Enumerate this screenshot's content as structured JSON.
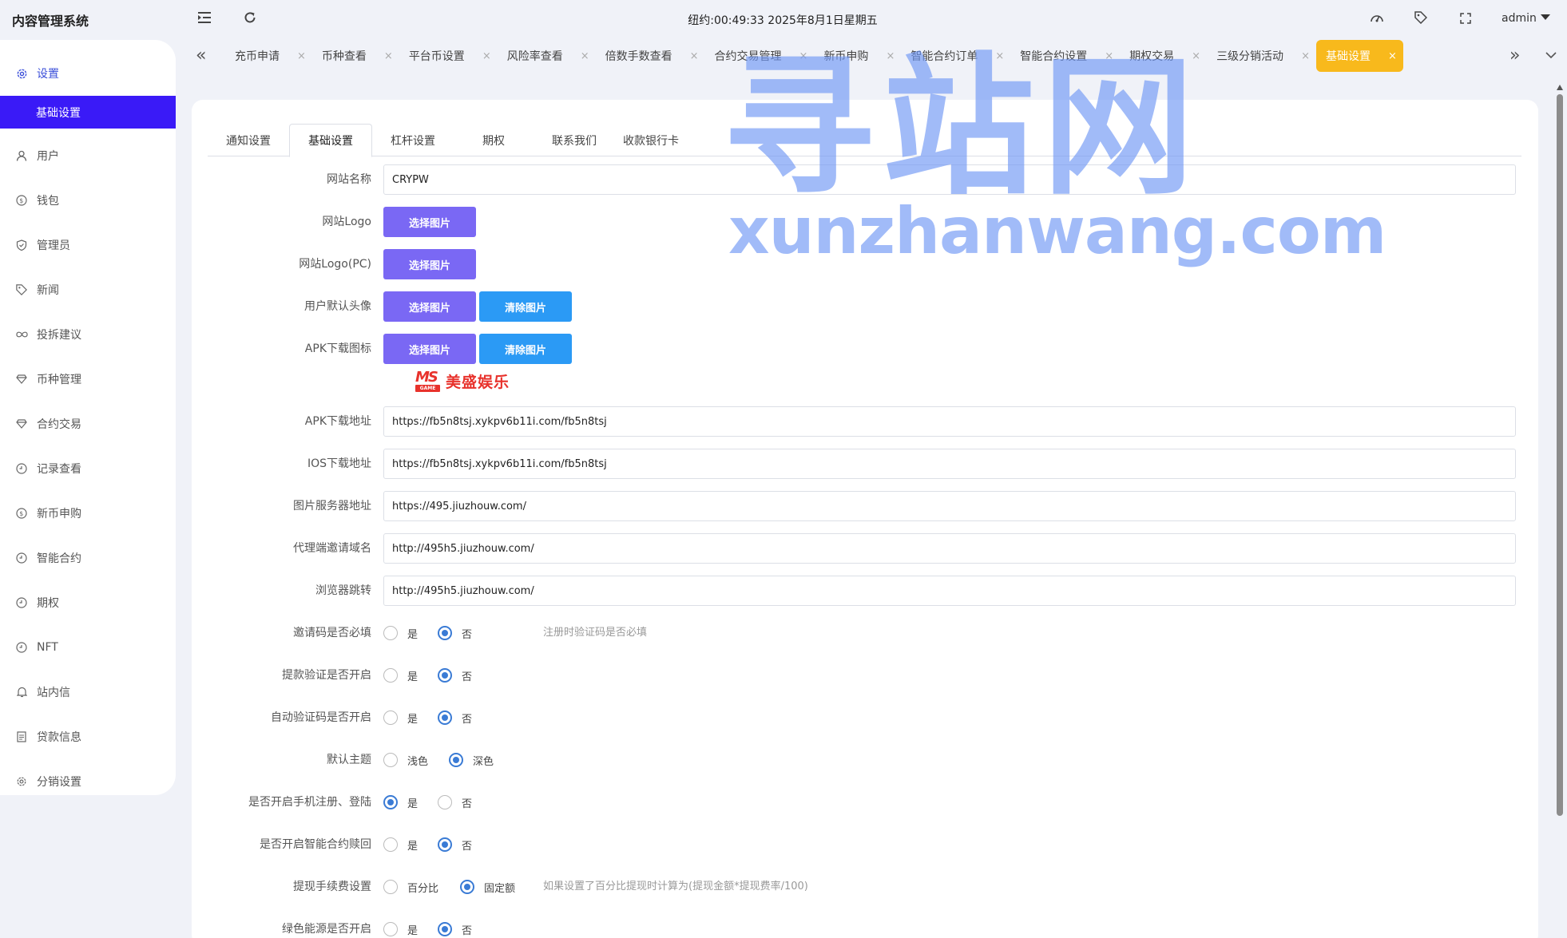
{
  "app": {
    "title": "内容管理系统"
  },
  "topbar": {
    "clock": "纽约:00:49:33 2025年8月1日星期五",
    "user": "admin"
  },
  "sidebar": {
    "items": [
      {
        "label": "设置",
        "icon": "gear-icon"
      },
      {
        "label": "基础设置",
        "icon": ""
      },
      {
        "label": "用户",
        "icon": "user-icon"
      },
      {
        "label": "钱包",
        "icon": "coin-icon"
      },
      {
        "label": "管理员",
        "icon": "shield-icon"
      },
      {
        "label": "新闻",
        "icon": "tag-icon"
      },
      {
        "label": "投拆建议",
        "icon": "infinity-icon"
      },
      {
        "label": "币种管理",
        "icon": "diamond-icon"
      },
      {
        "label": "合约交易",
        "icon": "diamond-icon"
      },
      {
        "label": "记录查看",
        "icon": "clock-icon"
      },
      {
        "label": "新币申购",
        "icon": "coin-icon"
      },
      {
        "label": "智能合约",
        "icon": "clock-icon"
      },
      {
        "label": "期权",
        "icon": "clock-icon"
      },
      {
        "label": "NFT",
        "icon": "clock-icon"
      },
      {
        "label": "站内信",
        "icon": "bell-icon"
      },
      {
        "label": "贷款信息",
        "icon": "document-icon"
      },
      {
        "label": "分销设置",
        "icon": "gear-icon"
      }
    ]
  },
  "tabs": [
    {
      "label": "充币申请"
    },
    {
      "label": "币种查看"
    },
    {
      "label": "平台币设置"
    },
    {
      "label": "风险率查看"
    },
    {
      "label": "倍数手数查看"
    },
    {
      "label": "合约交易管理"
    },
    {
      "label": "新币申购"
    },
    {
      "label": "智能合约订单"
    },
    {
      "label": "智能合约设置"
    },
    {
      "label": "期权交易"
    },
    {
      "label": "三级分销活动"
    },
    {
      "label": "基础设置"
    }
  ],
  "inner_tabs": [
    "通知设置",
    "基础设置",
    "杠杆设置",
    "期权",
    "联系我们",
    "收款银行卡"
  ],
  "form": {
    "site_name": {
      "label": "网站名称",
      "value": "CRYPW"
    },
    "site_logo": {
      "label": "网站Logo",
      "button": "选择图片"
    },
    "site_logo_pc": {
      "label": "网站Logo(PC)",
      "button": "选择图片"
    },
    "default_avatar": {
      "label": "用户默认头像",
      "select": "选择图片",
      "clear": "清除图片"
    },
    "apk_icon": {
      "label": "APK下载图标",
      "select": "选择图片",
      "clear": "清除图片",
      "preview_mark": "MS",
      "preview_sub": "GAME",
      "preview_text": "美盛娱乐"
    },
    "apk_url": {
      "label": "APK下载地址",
      "value": "https://fb5n8tsj.xykpv6b11i.com/fb5n8tsj"
    },
    "ios_url": {
      "label": "IOS下载地址",
      "value": "https://fb5n8tsj.xykpv6b11i.com/fb5n8tsj"
    },
    "img_server": {
      "label": "图片服务器地址",
      "value": "https://495.jiuzhouw.com/"
    },
    "agent_domain": {
      "label": "代理端邀请域名",
      "value": "http://495h5.jiuzhouw.com/"
    },
    "browser_redirect": {
      "label": "浏览器跳转",
      "value": "http://495h5.jiuzhouw.com/"
    },
    "invite_required": {
      "label": "邀请码是否必填",
      "yes": "是",
      "no": "否",
      "selected": "否",
      "hint": "注册时验证码是否必填"
    },
    "withdraw_verify": {
      "label": "提款验证是否开启",
      "yes": "是",
      "no": "否",
      "selected": "否"
    },
    "auto_verify": {
      "label": "自动验证码是否开启",
      "yes": "是",
      "no": "否",
      "selected": "否"
    },
    "theme": {
      "label": "默认主题",
      "light": "浅色",
      "dark": "深色",
      "selected": "深色"
    },
    "phone_register": {
      "label": "是否开启手机注册、登陆",
      "yes": "是",
      "no": "否",
      "selected": "是"
    },
    "contract_redeem": {
      "label": "是否开启智能合约赎回",
      "yes": "是",
      "no": "否",
      "selected": "否"
    },
    "withdraw_fee": {
      "label": "提现手续费设置",
      "percent": "百分比",
      "fixed": "固定额",
      "selected": "固定额",
      "hint": "如果设置了百分比提现时计算为(提现金额*提现费率/100)"
    },
    "green_energy": {
      "label": "绿色能源是否开启",
      "yes": "是",
      "no": "否",
      "selected": "否"
    }
  },
  "watermark": {
    "cn": "寻站网",
    "en": "xunzhanwang.com"
  },
  "colors": {
    "primary_nav": "#3a1af7",
    "active_tab": "#f8b91c",
    "btn_purple": "#7a68f4",
    "btn_blue": "#2b9af5",
    "radio": "#3a7bd5"
  }
}
